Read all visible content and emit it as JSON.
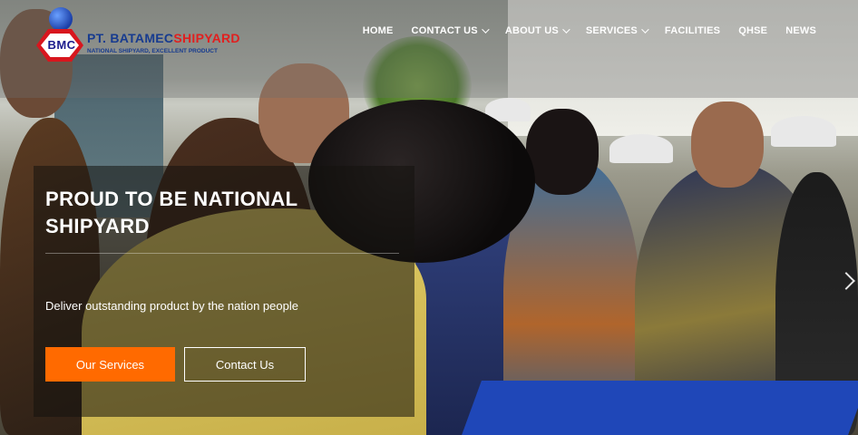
{
  "logo": {
    "mark": "BMC",
    "company_prefix": "PT. BATAMEC",
    "company_suffix": "SHIPYARD",
    "tagline": "NATIONAL SHIPYARD, EXCELLENT PRODUCT"
  },
  "nav": {
    "items": [
      {
        "label": "HOME",
        "has_dropdown": false
      },
      {
        "label": "CONTACT US",
        "has_dropdown": true
      },
      {
        "label": "ABOUT US",
        "has_dropdown": true
      },
      {
        "label": "SERVICES",
        "has_dropdown": true
      },
      {
        "label": "FACILITIES",
        "has_dropdown": false
      },
      {
        "label": "QHSE",
        "has_dropdown": false
      },
      {
        "label": "NEWS",
        "has_dropdown": false
      }
    ]
  },
  "hero": {
    "title_line1": "PROUD TO BE NATIONAL",
    "title_line2": "SHIPYARD",
    "subtitle": "Deliver outstanding product by the nation people",
    "primary_button": "Our Services",
    "secondary_button": "Contact Us",
    "next_icon": "chevron-right-icon"
  },
  "colors": {
    "accent": "#ff6a00",
    "logo_red": "#e11f1f",
    "logo_blue": "#173b8f"
  }
}
